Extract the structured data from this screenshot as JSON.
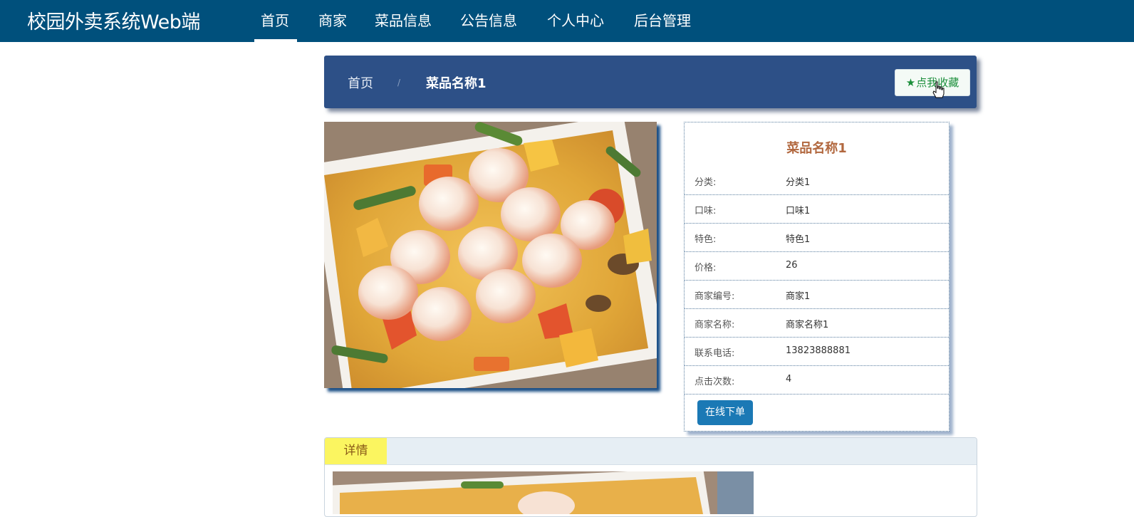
{
  "brand": "校园外卖系统Web端",
  "nav": {
    "items": [
      {
        "label": "首页",
        "active": true
      },
      {
        "label": "商家"
      },
      {
        "label": "菜品信息"
      },
      {
        "label": "公告信息"
      },
      {
        "label": "个人中心"
      },
      {
        "label": "后台管理"
      }
    ]
  },
  "breadcrumb": {
    "home": "首页",
    "separator": "/",
    "current": "菜品名称1"
  },
  "favorite": {
    "label": "点我收藏",
    "icon": "star-icon"
  },
  "product": {
    "image_alt": "shrimp-curry-dish",
    "title": "菜品名称1",
    "fields": [
      {
        "label": "分类:",
        "value": "分类1"
      },
      {
        "label": "口味:",
        "value": "口味1"
      },
      {
        "label": "特色:",
        "value": "特色1"
      },
      {
        "label": "价格:",
        "value": "26"
      },
      {
        "label": "商家编号:",
        "value": "商家1"
      },
      {
        "label": "商家名称:",
        "value": "商家名称1"
      },
      {
        "label": "联系电话:",
        "value": "13823888881"
      },
      {
        "label": "点击次数:",
        "value": "4"
      }
    ],
    "order_button": "在线下单"
  },
  "detail": {
    "tab": "详情"
  },
  "colors": {
    "nav_bg": "#00507c",
    "breadcrumb_bg": "#2d5087",
    "title_color": "#b2683f",
    "order_btn": "#1b79b5",
    "tab_highlight": "#fbf560"
  }
}
